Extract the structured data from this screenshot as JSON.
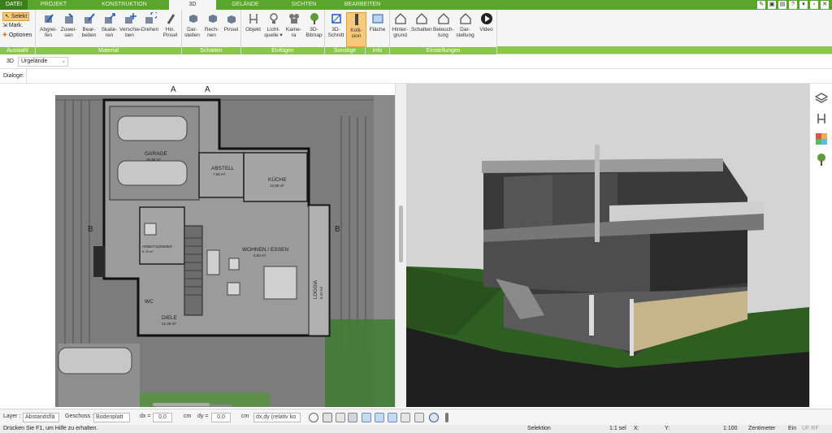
{
  "tabs": [
    "DATEI",
    "PROJEKT",
    "KONSTRUKTION",
    "3D",
    "GELÄNDE",
    "SICHTEN",
    "BEARBEITEN"
  ],
  "ribbon": {
    "auswahl": {
      "selekt": "Selekt",
      "mark": "Mark.",
      "optionen": "Optionen",
      "title": "Auswahl"
    },
    "material": {
      "buttons": [
        "Abgrei-\nfen",
        "Zuwei-\nsen",
        "Bear-\nbeiten",
        "Skalie-\nren",
        "Verschie-\nben",
        "Drehen",
        "Hin.\nPinsel"
      ],
      "title": "Material"
    },
    "schatten": {
      "buttons": [
        "Dar-\nstellen",
        "Rech-\nnen",
        "Pinsel"
      ],
      "title": "Schatten"
    },
    "einfuegen": {
      "buttons": [
        "Objekt",
        "Licht-\nquelle ▾",
        "Kame-\nra",
        "3D-\nBitmap"
      ],
      "title": "Einfügen"
    },
    "sonstige": {
      "buttons": [
        "3D-\nSchnitt",
        "Kolli-\nsion"
      ],
      "title": "Sonstige"
    },
    "info": {
      "buttons": [
        "Fläche"
      ],
      "title": "Info"
    },
    "einstellungen": {
      "buttons": [
        "Hinter-\ngrund",
        "Schatten",
        "Beleuch-\ntung",
        "Dar-\nstellung",
        "Video"
      ],
      "title": "Einstellungen"
    }
  },
  "viewbar": {
    "mode": "3D",
    "terrain": "Urgelände"
  },
  "dialoge": "Dialoge:",
  "plan": {
    "rooms": [
      {
        "name": "GARAGE",
        "area": "36,96 m²"
      },
      {
        "name": "ABSTELL",
        "area": "7,06 m²"
      },
      {
        "name": "KÜCHE",
        "area": "12,55 m²"
      },
      {
        "name": "WOHNEN / ESSEN",
        "area": "5,00 m²"
      },
      {
        "name": "ARBEITSZIMMER",
        "area": "5,78 m²"
      },
      {
        "name": "LOGGIA",
        "area": "6,42 m²"
      },
      {
        "name": "DIELE",
        "area": "12,45 m²"
      },
      {
        "name": "WC",
        "area": ""
      }
    ],
    "section_marks": [
      "A",
      "A",
      "B",
      "B"
    ]
  },
  "bottom": {
    "layer_label": "Layer :",
    "layer_value": "Abstandsflä",
    "geschoss_label": "Geschoss :",
    "geschoss_value": "Bodenplatt",
    "dx_label": "dx =",
    "dx_value": "0,0",
    "dx_unit": "cm",
    "dy_label": "dy =",
    "dy_value": "0,0",
    "dy_unit": "cm",
    "mode_value": "dx,dy (relativ kα"
  },
  "status": {
    "help": "Drücken Sie F1, um Hilfe zu erhalten.",
    "mode": "Selektion",
    "scale": "1:1 sel",
    "x": "X:",
    "y": "Y:",
    "ratio": "1:100",
    "unit": "Zentimeter",
    "ein": "Ein",
    "flags": "UF RF"
  },
  "colors": {
    "green_tab": "#5aa52b",
    "group_title": "#8ac64a",
    "highlight": "#f8c97a"
  }
}
